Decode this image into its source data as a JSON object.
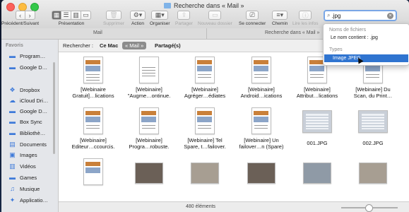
{
  "window": {
    "title": "Recherche dans « Mail »"
  },
  "toolbar": {
    "nav_label": "Précédent/Suivant",
    "view_label": "Présentation",
    "delete_label": "Supprimer",
    "action_label": "Action",
    "arrange_label": "Organiser",
    "share_label": "Partager",
    "new_folder_label": "Nouveau dossier",
    "connect_label": "Se connecter",
    "path_label": "Chemin",
    "info_label": "Lire les infos",
    "back_glyph": "‹",
    "forward_glyph": "›"
  },
  "search": {
    "value": ".jpg",
    "clear_glyph": "×"
  },
  "pathbar": {
    "left": "Mail",
    "right": "Recherche dans « Mail »"
  },
  "sidebar": {
    "header": "Favoris",
    "items": [
      {
        "label": "Program…",
        "icon": "folder-icon"
      },
      {
        "label": "Google D…",
        "icon": "folder-icon"
      },
      {
        "label": "Dropbox",
        "icon": "dropbox-icon"
      },
      {
        "label": "iCloud Dri…",
        "icon": "cloud-icon"
      },
      {
        "label": "Google D…",
        "icon": "folder-icon"
      },
      {
        "label": "Box Sync",
        "icon": "folder-icon"
      },
      {
        "label": "Bibliothè…",
        "icon": "folder-icon"
      },
      {
        "label": "Documents",
        "icon": "document-icon"
      },
      {
        "label": "Images",
        "icon": "images-icon"
      },
      {
        "label": "Vidéos",
        "icon": "film-icon"
      },
      {
        "label": "Games",
        "icon": "folder-icon"
      },
      {
        "label": "Musique",
        "icon": "music-icon"
      },
      {
        "label": "Applicatio…",
        "icon": "apps-icon"
      }
    ]
  },
  "scope": {
    "prefix": "Rechercher :",
    "this_mac": "Ce Mac",
    "mail": "« Mail »",
    "shared": "Partagé(s)"
  },
  "files": {
    "row1": [
      {
        "l1": "[Webinaire",
        "l2": "Gratuit]…lications"
      },
      {
        "l1": "[Webinaire]",
        "l2": "\"Augme…ontinue."
      },
      {
        "l1": "[Webinaire]",
        "l2": "Agréger…édiates"
      },
      {
        "l1": "[Webinaire]",
        "l2": "Android…ications"
      },
      {
        "l1": "[Webinaire]",
        "l2": "Attribut…lications"
      },
      {
        "l1": "[Webinaire] Du",
        "l2": "Scan, du Print…"
      }
    ],
    "row2": [
      {
        "l1": "[Webinaire]",
        "l2": "Editeur…ccourcis."
      },
      {
        "l1": "[Webinaire]",
        "l2": "Progra…robuste."
      },
      {
        "l1": "[Webinaire] Tel",
        "l2": "Spare, t…failover."
      },
      {
        "l1": "[Webinaire] Un",
        "l2": "failover…n (Spare)"
      },
      {
        "l1": "001.JPG",
        "l2": ""
      },
      {
        "l1": "002.JPG",
        "l2": ""
      }
    ]
  },
  "status": {
    "count": "480 éléments"
  },
  "dropdown": {
    "h1": "Noms de fichiers",
    "opt1": "Le nom contient : .jpg",
    "h2": "Types",
    "opt2": "Image JPEG"
  }
}
